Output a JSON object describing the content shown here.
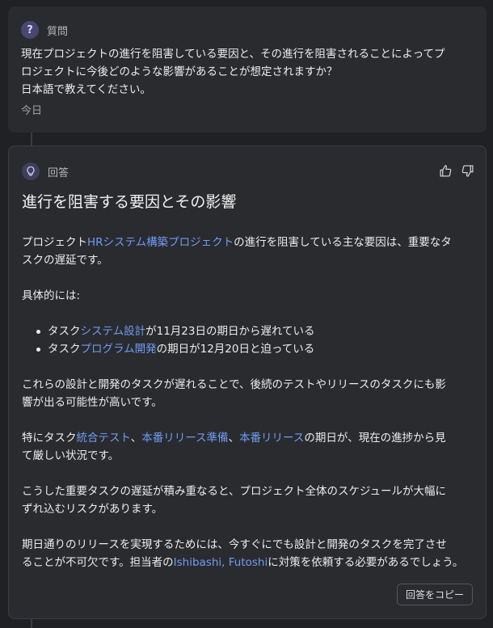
{
  "question": {
    "label": "質問",
    "badge": "?",
    "line1": "現在プロジェクトの進行を阻害している要因と、その進行を阻害されることによってプ",
    "line2": "ロジェクトに今後どのような影響があることが想定されますか？",
    "line3": "日本語で教えてください。",
    "date": "今日"
  },
  "answer": {
    "label": "回答",
    "title": "進行を阻害する要因とその影響",
    "p1": {
      "a": "プロジェクト",
      "link": "HRシステム構築プロジェクト",
      "b": "の進行を阻害している主な要因は、重要なタ",
      "c": "スクの遅延です。"
    },
    "p2": "具体的には:",
    "bullets": [
      {
        "a": "タスク",
        "link": "システム設計",
        "b": "が11月23日の期日から遅れている"
      },
      {
        "a": "タスク",
        "link": "プログラム開発",
        "b": "の期日が12月20日と迫っている"
      }
    ],
    "p3": {
      "line1": "これらの設計と開発のタスクが遅れることで、後続のテストやリリースのタスクにも影",
      "line2": "響が出る可能性が高いです。"
    },
    "p4": {
      "a": "特にタスク",
      "link1": "統合テスト",
      "sep1": "、",
      "link2": "本番リリース準備",
      "sep2": "、",
      "link3": "本番リリース",
      "b": "の期日が、現在の進捗から見",
      "c": "て厳しい状況です。"
    },
    "p5": {
      "line1": "こうした重要タスクの遅延が積み重なると、プロジェクト全体のスケジュールが大幅に",
      "line2": "ずれ込むリスクがあります。"
    },
    "p6": {
      "line1": "期日通りのリリースを実現するためには、今すぐにでも設計と開発のタスクを完了させ",
      "a": "ることが不可欠です。担当者の",
      "link": "Ishibashi, Futoshi",
      "b": "に対策を依頼する必要があるでしょう。"
    },
    "copy_label": "回答をコピー"
  },
  "colors": {
    "background": "#202124",
    "card": "#2a2b2f",
    "link": "#6f9cf3"
  },
  "icons": [
    "question-icon",
    "lightbulb-icon",
    "thumbs-up-icon",
    "thumbs-down-icon"
  ]
}
